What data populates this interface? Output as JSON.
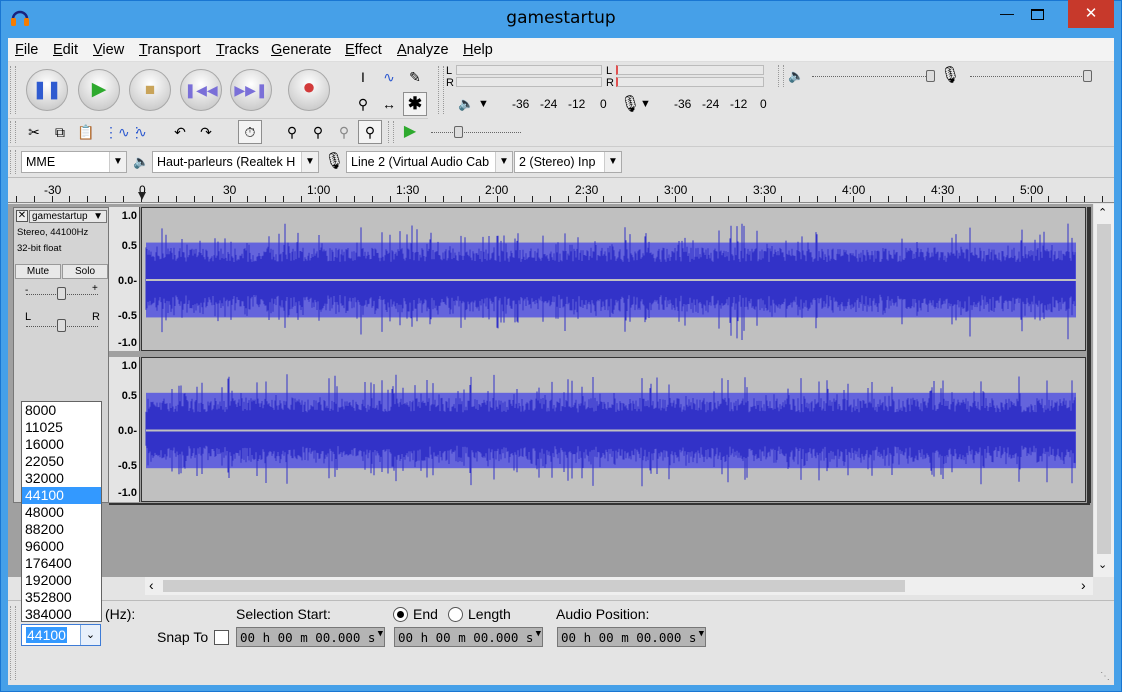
{
  "window": {
    "title": "gamestartup"
  },
  "menu": [
    "File",
    "Edit",
    "View",
    "Transport",
    "Tracks",
    "Generate",
    "Effect",
    "Analyze",
    "Help"
  ],
  "meters": {
    "playback_ticks": [
      "-36",
      "-24",
      "-12",
      "0"
    ],
    "record_ticks": [
      "-36",
      "-24",
      "-12",
      "0"
    ],
    "channel_labels": [
      "L",
      "R"
    ]
  },
  "device": {
    "host": "MME",
    "playback_device": "Haut-parleurs (Realtek H",
    "record_device": "Line 2 (Virtual Audio Cab",
    "channels": "2 (Stereo) Inp"
  },
  "ruler": {
    "labels": [
      "-30",
      "0",
      "30",
      "1:00",
      "1:30",
      "2:00",
      "2:30",
      "3:00",
      "3:30",
      "4:00",
      "4:30",
      "5:00"
    ]
  },
  "track": {
    "name": "gamestartup",
    "format_line1": "Stereo, 44100Hz",
    "format_line2": "32-bit float",
    "mute_label": "Mute",
    "solo_label": "Solo",
    "gain_minus": "-",
    "gain_plus": "+",
    "pan_left": "L",
    "pan_right": "R",
    "scale": [
      "1.0",
      "0.5",
      "0.0-",
      "-0.5",
      "-1.0"
    ]
  },
  "project_rate": {
    "label_partial": "(Hz):",
    "value": "44100",
    "options": [
      "8000",
      "11025",
      "16000",
      "22050",
      "32000",
      "44100",
      "48000",
      "88200",
      "96000",
      "176400",
      "192000",
      "352800",
      "384000"
    ],
    "selected_index": 5
  },
  "selection": {
    "snap_to_label": "Snap To",
    "start_label": "Selection Start:",
    "end_label": "End",
    "length_label": "Length",
    "end_selected": true,
    "audio_position_label": "Audio Position:",
    "start_value": "00 h 00 m 00.000 s",
    "end_value": "00 h 00 m 00.000 s",
    "position_value": "00 h 00 m 00.000 s"
  },
  "colors": {
    "waveform": "#3232c8",
    "waveform_light": "#6464dc",
    "track_bg": "#c0c0c0",
    "close_button": "#c7392b"
  }
}
